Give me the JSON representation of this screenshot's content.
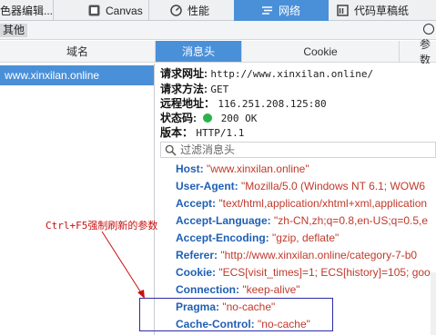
{
  "tabs": [
    {
      "label": "色器编辑...",
      "icon": "editor-icon"
    },
    {
      "label": "Canvas",
      "icon": "canvas-icon"
    },
    {
      "label": "性能",
      "icon": "performance-icon"
    },
    {
      "label": "网络",
      "icon": "network-icon",
      "active": true
    },
    {
      "label": "代码草稿纸",
      "icon": "scratchpad-icon"
    }
  ],
  "filter": {
    "label": "其他"
  },
  "columns": {
    "domain": "域名",
    "headers": "消息头",
    "cookie": "Cookie",
    "params": "参数"
  },
  "domains": [
    {
      "name": "www.xinxilan.online",
      "selected": true
    }
  ],
  "summary": {
    "url_label": "请求网址:",
    "url_value": "http://www.xinxilan.online/",
    "method_label": "请求方法:",
    "method_value": "GET",
    "remote_label": "远程地址：",
    "remote_value": "116.251.208.125:80",
    "status_label": "状态码:",
    "status_value": "200 OK",
    "status_color": "#2bb24c",
    "version_label": "版本：",
    "version_value": "HTTP/1.1"
  },
  "search": {
    "placeholder": "过滤消息头"
  },
  "headers": [
    {
      "name": "Host:",
      "value": "\"www.xinxilan.online\""
    },
    {
      "name": "User-Agent:",
      "value": "\"Mozilla/5.0 (Windows NT 6.1; WOW6"
    },
    {
      "name": "Accept:",
      "value": "\"text/html,application/xhtml+xml,application"
    },
    {
      "name": "Accept-Language:",
      "value": "\"zh-CN,zh;q=0.8,en-US;q=0.5,e"
    },
    {
      "name": "Accept-Encoding:",
      "value": "\"gzip, deflate\""
    },
    {
      "name": "Referer:",
      "value": "\"http://www.xinxilan.online/category-7-b0"
    },
    {
      "name": "Cookie:",
      "value": "\"ECS[visit_times]=1; ECS[history]=105; goo"
    },
    {
      "name": "Connection:",
      "value": "\"keep-alive\""
    },
    {
      "name": "Pragma:",
      "value": "\"no-cache\""
    },
    {
      "name": "Cache-Control:",
      "value": "\"no-cache\""
    }
  ],
  "annotation": {
    "text": "Ctrl+F5强制刷新的参数",
    "color": "#c81010"
  },
  "colors": {
    "accent": "#4a90d9",
    "header_name": "#1f5fb4",
    "header_value": "#c0392b",
    "box": "#2a2aa8"
  }
}
